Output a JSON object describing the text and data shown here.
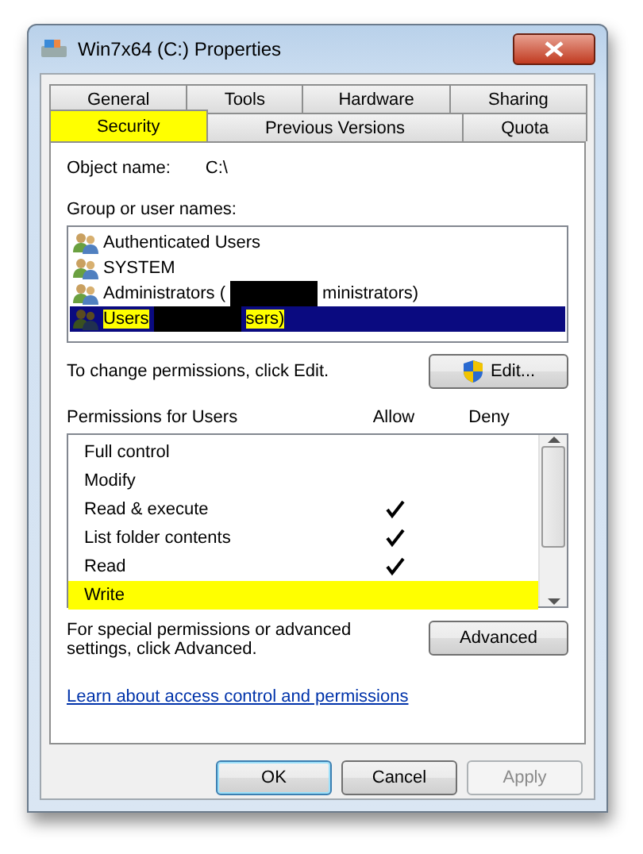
{
  "window": {
    "title": "Win7x64 (C:) Properties"
  },
  "tab_rows": [
    {
      "tabs": [
        {
          "label": "General",
          "selected": false,
          "highlighted": false
        },
        {
          "label": "Tools",
          "selected": false,
          "highlighted": false
        },
        {
          "label": "Hardware",
          "selected": false,
          "highlighted": false
        },
        {
          "label": "Sharing",
          "selected": false,
          "highlighted": false
        }
      ]
    },
    {
      "tabs": [
        {
          "label": "Security",
          "selected": true,
          "highlighted": true
        },
        {
          "label": "Previous Versions",
          "selected": false,
          "highlighted": false
        },
        {
          "label": "Quota",
          "selected": false,
          "highlighted": false
        }
      ]
    }
  ],
  "object_name": {
    "label": "Object name:",
    "value": "C:\\"
  },
  "groups": {
    "label": "Group or user names:",
    "items": [
      {
        "label_parts": [
          "Authenticated Users"
        ],
        "selected": false,
        "highlighted": false
      },
      {
        "label_parts": [
          "SYSTEM"
        ],
        "selected": false,
        "highlighted": false
      },
      {
        "label_parts": [
          "Administrators (",
          "ministrators)"
        ],
        "selected": false,
        "highlighted": false
      },
      {
        "label_parts": [
          "Users",
          "sers)"
        ],
        "selected": true,
        "highlighted": true
      }
    ]
  },
  "edit_hint": "To change permissions, click Edit.",
  "edit_button": "Edit...",
  "permissions": {
    "label": "Permissions for Users",
    "allow_header": "Allow",
    "deny_header": "Deny",
    "rows": [
      {
        "name": "Full control",
        "allow": false,
        "deny": false,
        "highlighted": false
      },
      {
        "name": "Modify",
        "allow": false,
        "deny": false,
        "highlighted": false
      },
      {
        "name": "Read & execute",
        "allow": true,
        "deny": false,
        "highlighted": false
      },
      {
        "name": "List folder contents",
        "allow": true,
        "deny": false,
        "highlighted": false
      },
      {
        "name": "Read",
        "allow": true,
        "deny": false,
        "highlighted": false
      },
      {
        "name": "Write",
        "allow": false,
        "deny": false,
        "highlighted": true
      }
    ]
  },
  "advanced_hint": "For special permissions or advanced settings, click Advanced.",
  "advanced_button": "Advanced",
  "learn_link": "Learn about access control and permissions",
  "buttons": [
    {
      "label": "OK",
      "disabled": false,
      "default": true
    },
    {
      "label": "Cancel",
      "disabled": false,
      "default": false
    },
    {
      "label": "Apply",
      "disabled": true,
      "default": false
    }
  ]
}
